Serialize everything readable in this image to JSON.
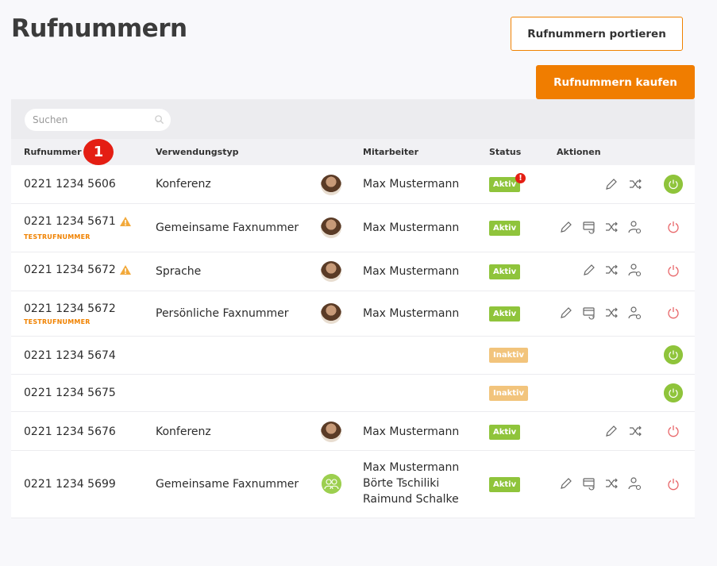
{
  "page": {
    "title": "Rufnummern"
  },
  "buttons": {
    "port": "Rufnummern portieren",
    "buy": "Rufnummern kaufen"
  },
  "search": {
    "placeholder": "Suchen"
  },
  "annotation_badge": "1",
  "columns": {
    "rufnummer": "Rufnummer",
    "verwendungstyp": "Verwendungstyp",
    "mitarbeiter": "Mitarbeiter",
    "status": "Status",
    "aktionen": "Aktionen"
  },
  "rows": [
    {
      "number": "0221 1234 5606",
      "sub": "",
      "warning": false,
      "type": "Konferenz",
      "employee": "Max Mustermann",
      "status": "Aktiv",
      "status_alert": "!"
    },
    {
      "number": "0221 1234 5671",
      "sub": "TESTRUFNUMMER",
      "warning": true,
      "type": "Gemeinsame Faxnummer",
      "employee": "Max Mustermann",
      "status": "Aktiv"
    },
    {
      "number": "0221 1234 5672",
      "sub": "",
      "warning": true,
      "type": "Sprache",
      "employee": "Max Mustermann",
      "status": "Aktiv"
    },
    {
      "number": "0221 1234 5672",
      "sub": "TESTRUFNUMMER",
      "warning": false,
      "type": "Persönliche Faxnummer",
      "employee": "Max Mustermann",
      "status": "Aktiv"
    },
    {
      "number": "0221 1234 5674",
      "sub": "",
      "warning": false,
      "type": "",
      "employee": "",
      "status": "Inaktiv"
    },
    {
      "number": "0221 1234 5675",
      "sub": "",
      "warning": false,
      "type": "",
      "employee": "",
      "status": "Inaktiv"
    },
    {
      "number": "0221 1234 5676",
      "sub": "",
      "warning": false,
      "type": "Konferenz",
      "employee": "Max Mustermann",
      "status": "Aktiv"
    },
    {
      "number": "0221 1234 5699",
      "sub": "",
      "warning": false,
      "type": "Gemeinsame Faxnummer",
      "employees": [
        "Max Mustermann",
        "Börte Tschiliki",
        "Raimund Schalke"
      ],
      "status": "Aktiv"
    }
  ],
  "icons": {
    "search": "search-icon",
    "warning": "warning-icon",
    "edit": "pencil-icon",
    "forward": "call-forward-icon",
    "shuffle": "shuffle-icon",
    "assign": "user-assign-icon",
    "power_on": "power-on-icon",
    "power_off": "power-off-icon",
    "group": "group-avatar-icon"
  },
  "colors": {
    "accent": "#f07d00",
    "active": "#8fc43b",
    "inactive": "#f2c47c",
    "alert": "#e41e13",
    "off": "#e8676a"
  }
}
